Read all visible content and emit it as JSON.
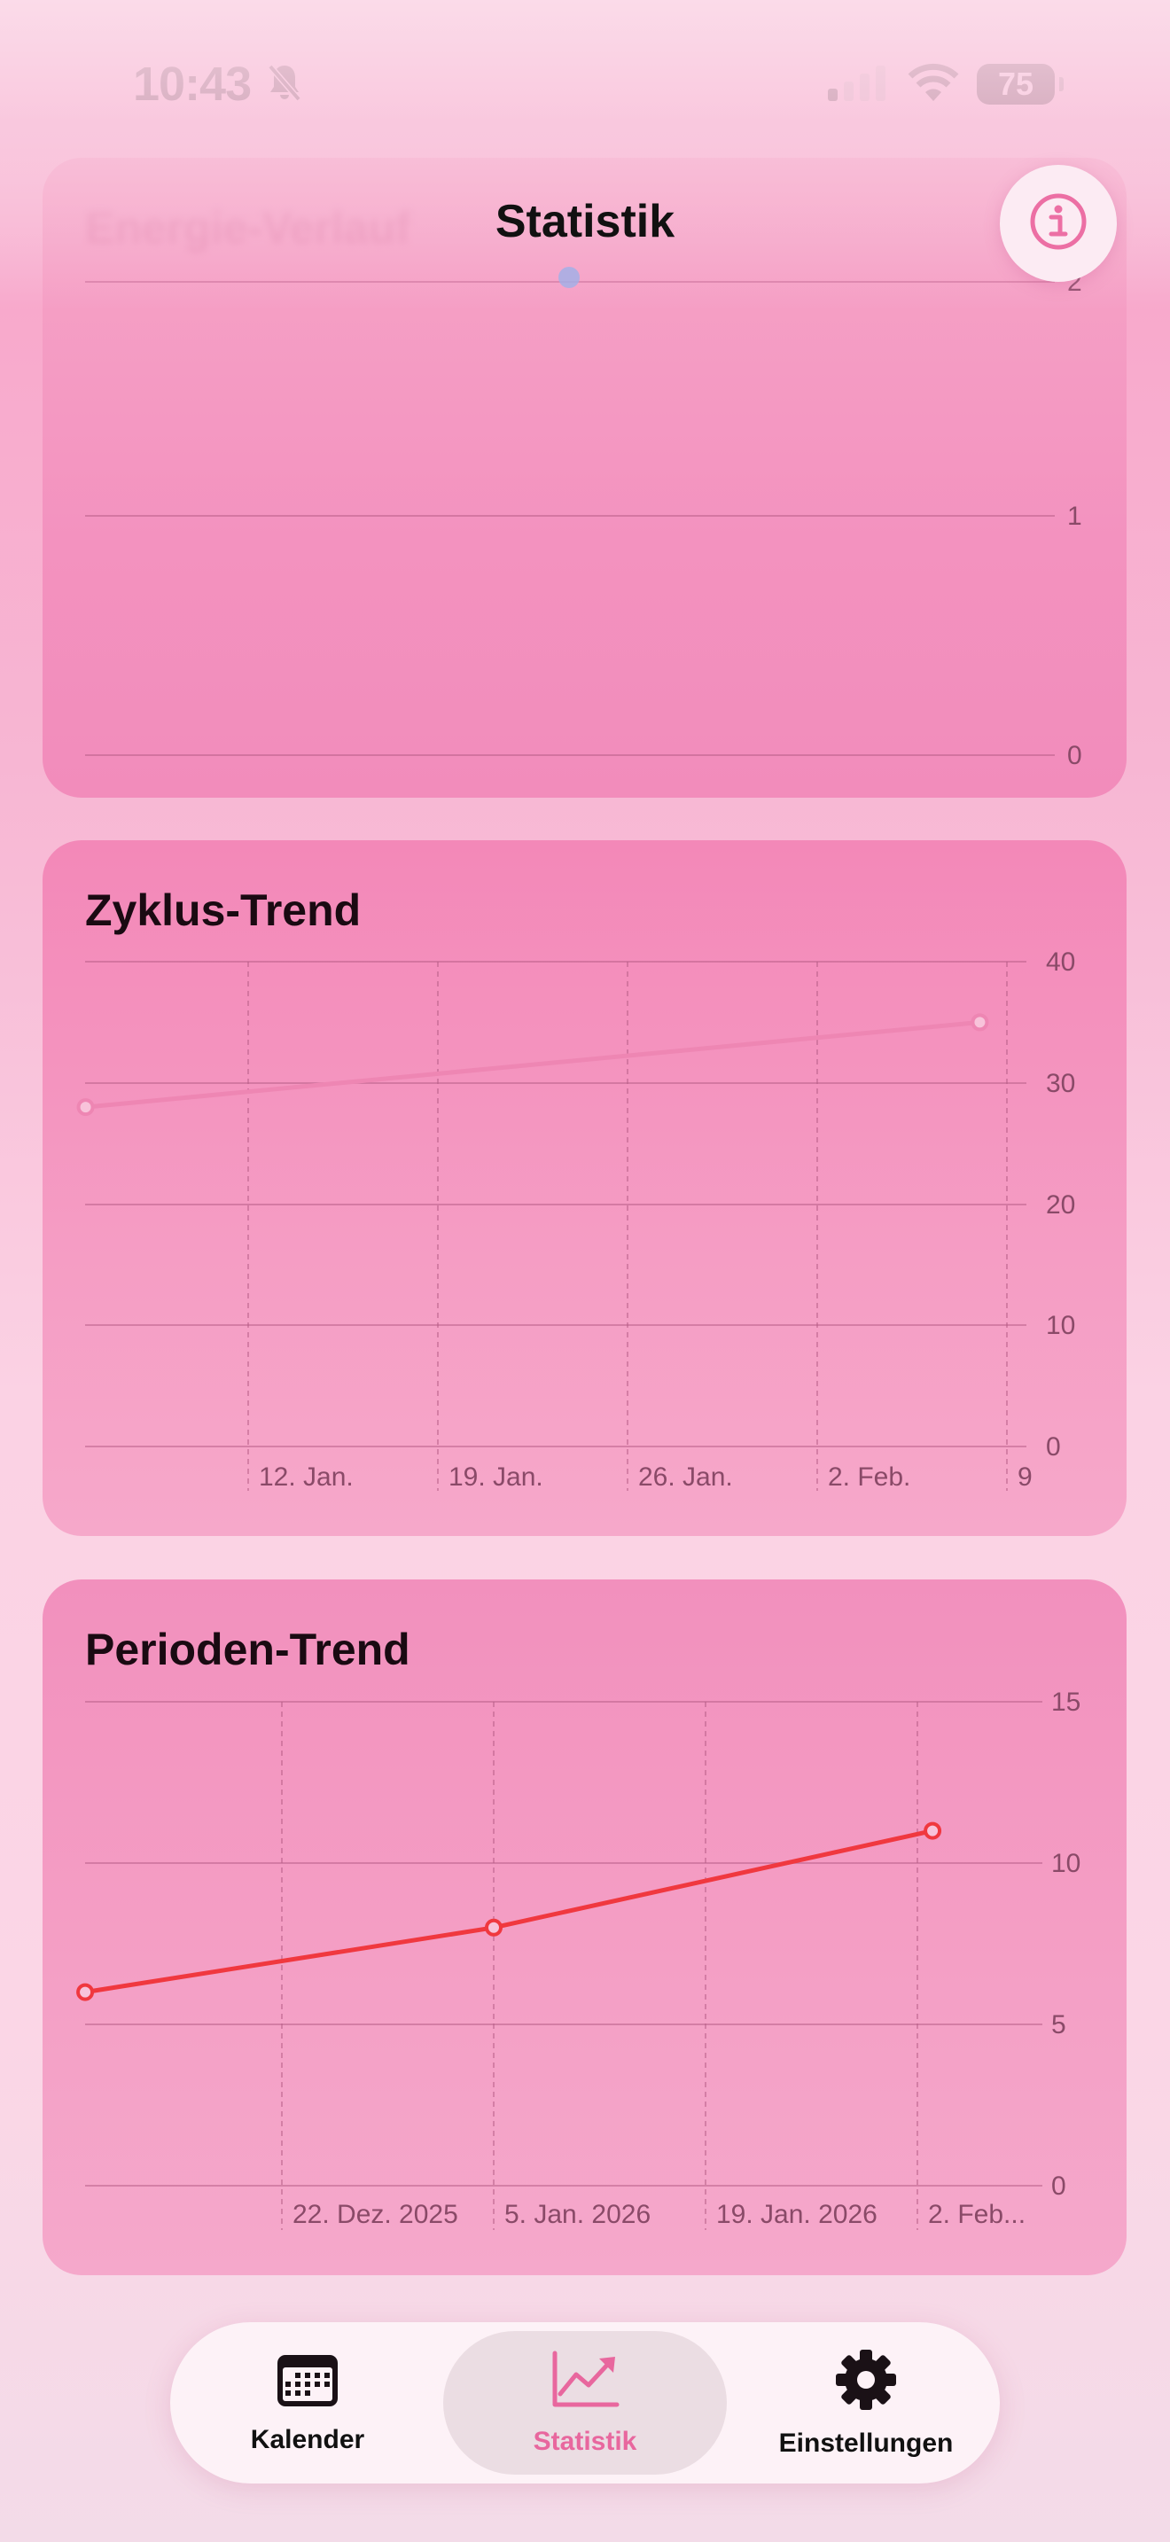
{
  "status_bar": {
    "time": "10:43",
    "battery": "75"
  },
  "header": {
    "title": "Statistik"
  },
  "cards": {
    "energy": {
      "title": "Energie-Verlauf"
    },
    "cycle": {
      "title": "Zyklus-Trend"
    },
    "period": {
      "title": "Perioden-Trend"
    }
  },
  "chart_data": [
    {
      "type": "line",
      "title": "Energie-Verlauf",
      "y_ticks": [
        "2",
        "1",
        "0"
      ],
      "ylim": [
        0,
        2
      ],
      "grid": true,
      "series": []
    },
    {
      "type": "line",
      "title": "Zyklus-Trend",
      "x_ticks": [
        "12. Jan.",
        "19. Jan.",
        "26. Jan.",
        "2. Feb.",
        "9"
      ],
      "y_ticks": [
        "40",
        "30",
        "20",
        "10",
        "0"
      ],
      "ylim": [
        0,
        40
      ],
      "grid": true,
      "color": "#ee86b3",
      "series": [
        {
          "points": [
            {
              "x": "2026-01-06",
              "y": 28
            },
            {
              "x": "2026-02-08",
              "y": 35
            }
          ]
        }
      ]
    },
    {
      "type": "line",
      "title": "Perioden-Trend",
      "x_ticks": [
        "22. Dez. 2025",
        "5. Jan. 2026",
        "19. Jan. 2026",
        "2. Feb..."
      ],
      "y_ticks": [
        "15",
        "10",
        "5",
        "0"
      ],
      "ylim": [
        0,
        15
      ],
      "grid": true,
      "color": "#f0383f",
      "series": [
        {
          "points": [
            {
              "x": "2025-12-09",
              "y": 6
            },
            {
              "x": "2026-01-05",
              "y": 8
            },
            {
              "x": "2026-02-03",
              "y": 11
            }
          ]
        }
      ]
    }
  ],
  "tabs": [
    {
      "label": "Kalender",
      "icon": "calendar-icon"
    },
    {
      "label": "Statistik",
      "icon": "chart-icon",
      "active": true
    },
    {
      "label": "Einstellungen",
      "icon": "gear-icon"
    }
  ]
}
